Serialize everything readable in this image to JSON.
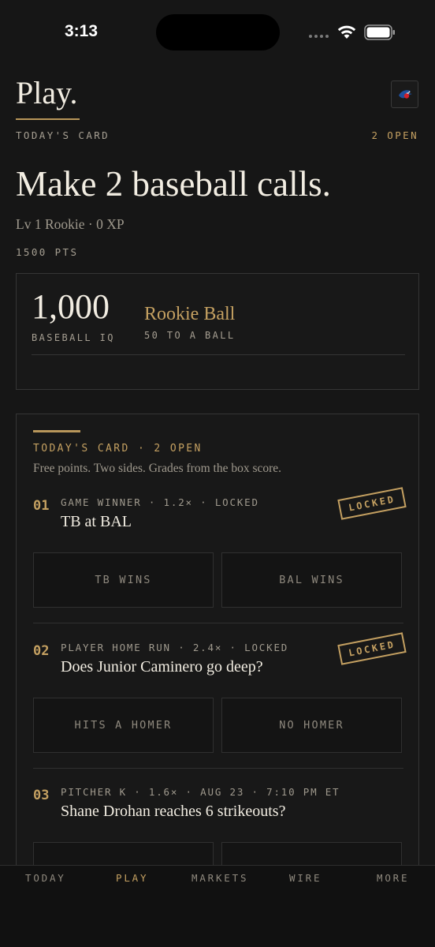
{
  "status": {
    "time": "3:13"
  },
  "header": {
    "title": "Play.",
    "section_label": "TODAY'S CARD",
    "open_count": "2 OPEN",
    "team_logo_icon": "blue-jays-logo-icon"
  },
  "hero": {
    "headline": "Make 2 baseball calls.",
    "level": "Lv 1 Rookie · 0 XP",
    "points": "1500 PTS"
  },
  "iq_panel": {
    "value": "1,000",
    "label": "BASEBALL IQ",
    "tier_name": "Rookie Ball",
    "tier_sub": "50 TO A BALL"
  },
  "card": {
    "label": "TODAY'S CARD · 2 OPEN",
    "description": "Free points. Two sides. Grades from the box score.",
    "calls": [
      {
        "number": "01",
        "meta": "GAME WINNER · 1.2× · LOCKED",
        "question": "TB at BAL",
        "stamp": "LOCKED",
        "options": [
          "TB WINS",
          "BAL WINS"
        ]
      },
      {
        "number": "02",
        "meta": "PLAYER HOME RUN · 2.4× · LOCKED",
        "question": "Does Junior Caminero go deep?",
        "stamp": "LOCKED",
        "options": [
          "HITS A HOMER",
          "NO HOMER"
        ]
      },
      {
        "number": "03",
        "meta": "PITCHER K · 1.6× · AUG 23 · 7:10 PM ET",
        "question": "Shane Drohan reaches 6 strikeouts?",
        "stamp": "",
        "options": [
          "",
          ""
        ]
      }
    ]
  },
  "nav": {
    "items": [
      "TODAY",
      "PLAY",
      "MARKETS",
      "WIRE",
      "MORE"
    ],
    "active": "PLAY"
  },
  "colors": {
    "background": "#161616",
    "accent_gold": "#c4a061",
    "text_primary": "#f2ede2",
    "text_muted": "#9f998d"
  }
}
